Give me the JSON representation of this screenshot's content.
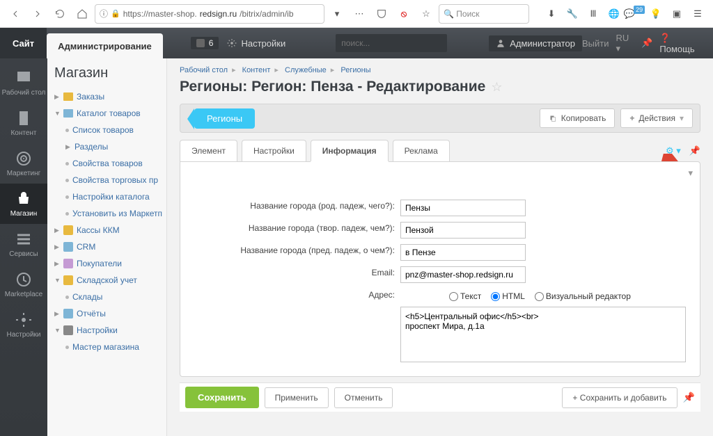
{
  "browser": {
    "url_host": "redsign.ru",
    "url_pre": "https://master-shop.",
    "url_post": "/bitrix/admin/ib",
    "search_placeholder": "Поиск",
    "badge": "29"
  },
  "topnav": {
    "site": "Сайт",
    "admin": "Администрирование",
    "notif_count": "6",
    "settings": "Настройки",
    "search_placeholder": "поиск...",
    "user": "Администратор",
    "logout": "Выйти",
    "lang": "RU",
    "help": "Помощь"
  },
  "rail": [
    {
      "label": "Рабочий стол"
    },
    {
      "label": "Контент"
    },
    {
      "label": "Маркетинг"
    },
    {
      "label": "Магазин"
    },
    {
      "label": "Сервисы"
    },
    {
      "label": "Marketplace"
    },
    {
      "label": "Настройки"
    }
  ],
  "tree": {
    "title": "Магазин",
    "items": [
      {
        "l": 1,
        "type": "folder-y",
        "label": "Заказы",
        "tri": "▶"
      },
      {
        "l": 1,
        "type": "folder-b",
        "label": "Каталог товаров",
        "tri": "▼"
      },
      {
        "l": 2,
        "type": "dot",
        "label": "Список товаров"
      },
      {
        "l": 2,
        "type": "tri",
        "label": "Разделы"
      },
      {
        "l": 2,
        "type": "dot",
        "label": "Свойства товаров"
      },
      {
        "l": 2,
        "type": "dot",
        "label": "Свойства торговых пр"
      },
      {
        "l": 2,
        "type": "dot",
        "label": "Настройки каталога"
      },
      {
        "l": 2,
        "type": "dot",
        "label": "Установить из Маркетп"
      },
      {
        "l": 1,
        "type": "ic",
        "label": "Кассы ККМ",
        "tri": "▶",
        "color": "#e8b93f"
      },
      {
        "l": 1,
        "type": "ic",
        "label": "CRM",
        "tri": "▶",
        "color": "#7eb5d6"
      },
      {
        "l": 1,
        "type": "ic",
        "label": "Покупатели",
        "tri": "▶",
        "color": "#c59bd4"
      },
      {
        "l": 1,
        "type": "ic",
        "label": "Складской учет",
        "tri": "▼",
        "color": "#e8b93f"
      },
      {
        "l": 2,
        "type": "dot",
        "label": "Склады"
      },
      {
        "l": 1,
        "type": "ic",
        "label": "Отчёты",
        "tri": "▶",
        "color": "#7eb5d6"
      },
      {
        "l": 1,
        "type": "ic",
        "label": "Настройки",
        "tri": "▼",
        "color": "#888"
      },
      {
        "l": 2,
        "type": "dot",
        "label": "Мастер магазина"
      }
    ]
  },
  "crumbs": [
    "Рабочий стол",
    "Контент",
    "Служебные",
    "Регионы"
  ],
  "page_title": "Регионы: Регион: Пенза - Редактирование",
  "toolbar": {
    "back": "Регионы",
    "copy": "Копировать",
    "actions": "Действия"
  },
  "tabs": [
    "Элемент",
    "Настройки",
    "Информация",
    "Реклама"
  ],
  "active_tab": 2,
  "form": {
    "f1_label": "Название города (род. падеж, чего?):",
    "f1_value": "Пензы",
    "f2_label": "Название города (твор. падеж, чем?):",
    "f2_value": "Пензой",
    "f3_label": "Название города (пред. падеж, о чем?):",
    "f3_value": "в Пензе",
    "f4_label": "Email:",
    "f4_value": "pnz@master-shop.redsign.ru",
    "f5_label": "Адрес:",
    "r1": "Текст",
    "r2": "HTML",
    "r3": "Визуальный редактор",
    "ta": "<h5>Центральный офис</h5><br>\nпроспект Мира, д.1а"
  },
  "footer": {
    "save": "Сохранить",
    "apply": "Применить",
    "cancel": "Отменить",
    "save_add": "Сохранить и добавить"
  }
}
